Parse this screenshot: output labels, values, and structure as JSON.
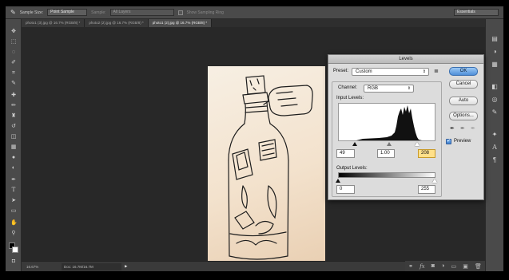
{
  "options_bar": {
    "sample_size_label": "Sample Size:",
    "sample_size_value": "Point Sample",
    "sample_label": "Sample:",
    "sample_value": "All Layers",
    "show_ring_label": "Show Sampling Ring",
    "workspace": "Essentials"
  },
  "tabs": [
    {
      "label": "photo1 (3).jpg @ 16.7% (RGB/8) *"
    },
    {
      "label": "photo2 (2).jpg @ 16.7% (RGB/8) *"
    },
    {
      "label": "photo1 (2).jpg @ 16.7% (RGB/8) *"
    }
  ],
  "status": {
    "zoom": "16.67%",
    "doc": "Doc: 16.7M/16.7M"
  },
  "levels_dialog": {
    "title": "Levels",
    "preset_label": "Preset:",
    "preset_value": "Custom",
    "channel_label": "Channel:",
    "channel_value": "RGB",
    "input_levels_label": "Input Levels:",
    "input_black": "49",
    "input_gamma": "1.00",
    "input_white": "208",
    "output_levels_label": "Output Levels:",
    "output_black": "0",
    "output_white": "255",
    "ok_label": "OK",
    "cancel_label": "Cancel",
    "auto_label": "Auto",
    "options_label": "Options...",
    "preview_label": "Preview",
    "preview_checked": true
  },
  "colors": {
    "ok_button": "#4f8fd8",
    "highlight_field": "#ffe08a",
    "canvas_bg": "#282828",
    "paper": "#f3e2cd"
  }
}
